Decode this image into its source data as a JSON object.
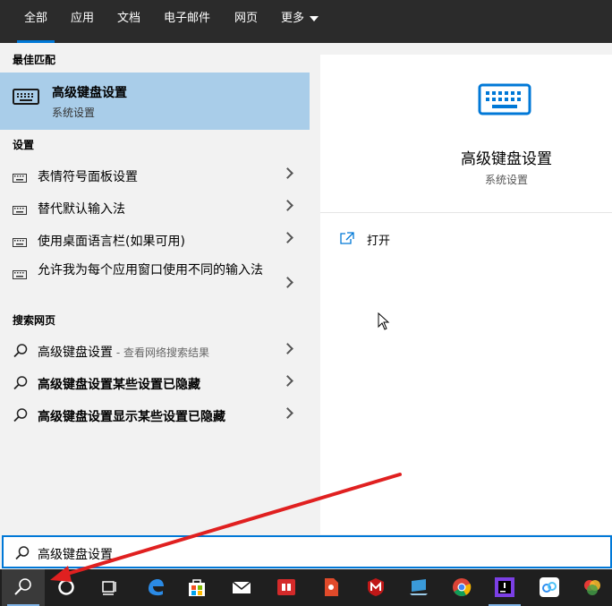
{
  "tabs": [
    {
      "label": "全部",
      "active": true
    },
    {
      "label": "应用"
    },
    {
      "label": "文档"
    },
    {
      "label": "电子邮件"
    },
    {
      "label": "网页"
    },
    {
      "label": "更多"
    }
  ],
  "best_match": {
    "header": "最佳匹配",
    "title": "高级键盘设置",
    "subtitle": "系统设置",
    "icon": "keyboard-icon"
  },
  "settings": {
    "header": "设置",
    "items": [
      {
        "label": "表情符号面板设置",
        "icon": "keyboard-icon"
      },
      {
        "label": "替代默认输入法",
        "icon": "keyboard-icon"
      },
      {
        "label": "使用桌面语言栏(如果可用)",
        "icon": "keyboard-icon"
      },
      {
        "label": "允许我为每个应用窗口使用不同的输入法",
        "icon": "keyboard-icon"
      }
    ]
  },
  "web": {
    "header": "搜索网页",
    "items": [
      {
        "label": "高级键盘设置",
        "hint": " - 查看网络搜索结果",
        "icon": "search-icon"
      },
      {
        "label": "高级键盘设置某些设置已隐藏",
        "icon": "search-icon"
      },
      {
        "label": "高级键盘设置显示某些设置已隐藏",
        "icon": "search-icon"
      }
    ]
  },
  "preview": {
    "title": "高级键盘设置",
    "subtitle": "系统设置",
    "actions": [
      {
        "label": "打开",
        "icon": "open-icon"
      }
    ]
  },
  "search": {
    "value": "高级键盘设置"
  },
  "taskbar": {
    "items": [
      "search-icon",
      "cortana-icon",
      "task-view-icon",
      "edge-icon",
      "store-icon",
      "mail-icon",
      "app-red-book-icon",
      "app-red-file-icon",
      "mcafee-icon",
      "pc-icon",
      "chrome-icon",
      "jetbrains-icon",
      "baidu-netdisk-icon",
      "app-colorful-icon"
    ]
  },
  "colors": {
    "accent": "#0078d7",
    "selection": "#a9cde9",
    "annotation": "#e02020",
    "tabbar": "#2b2b2b",
    "taskbar": "#1f1f1f"
  }
}
